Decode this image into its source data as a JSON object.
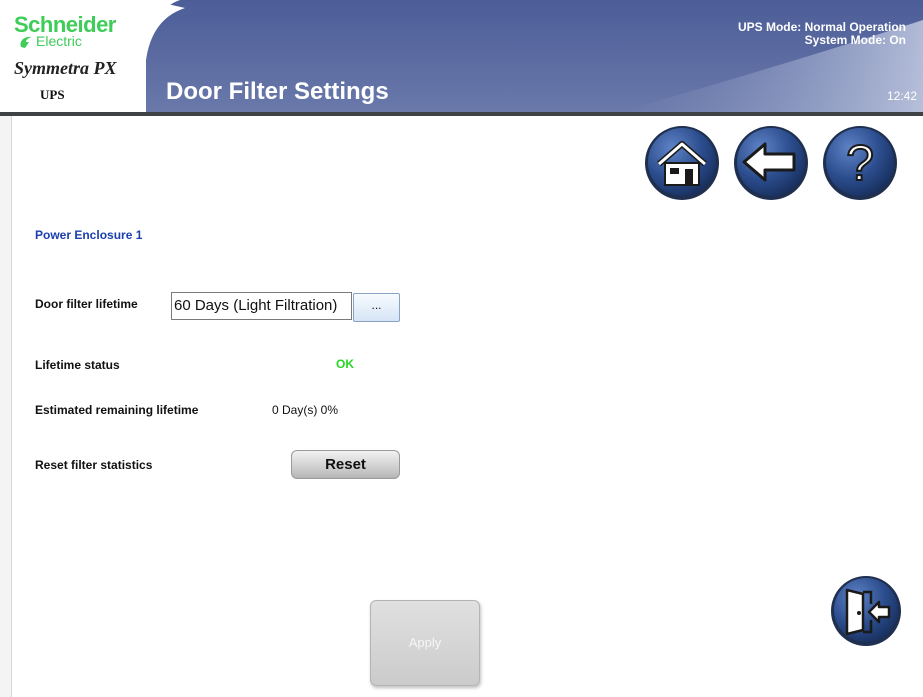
{
  "header": {
    "brand_name": "Schneider",
    "brand_sub": "Electric",
    "product_name": "Symmetra PX",
    "product_type": "UPS",
    "page_title": "Door Filter Settings",
    "ups_mode": "UPS Mode: Normal Operation",
    "system_mode": "System Mode: On",
    "clock": "12:42",
    "colors": {
      "banner": "#56679f",
      "brand": "#3dcd58",
      "divider": "#3f4244"
    }
  },
  "nav": {
    "home_icon": "home-icon",
    "back_icon": "back-arrow-icon",
    "help_icon": "help-icon",
    "exit_icon": "exit-door-icon"
  },
  "content": {
    "section_title": "Power Enclosure 1",
    "door_filter_lifetime_label": "Door filter lifetime",
    "door_filter_lifetime_value": "60 Days (Light Filtration)",
    "browse_label": "...",
    "lifetime_status_label": "Lifetime status",
    "lifetime_status_value": "OK",
    "remaining_label": "Estimated remaining lifetime",
    "remaining_value": "0 Day(s) 0%",
    "reset_label": "Reset filter statistics",
    "reset_button": "Reset",
    "apply_button": "Apply",
    "colors": {
      "section_title": "#1a3fae",
      "status_ok": "#27d627",
      "button_blue": "#2b4c8c"
    }
  }
}
